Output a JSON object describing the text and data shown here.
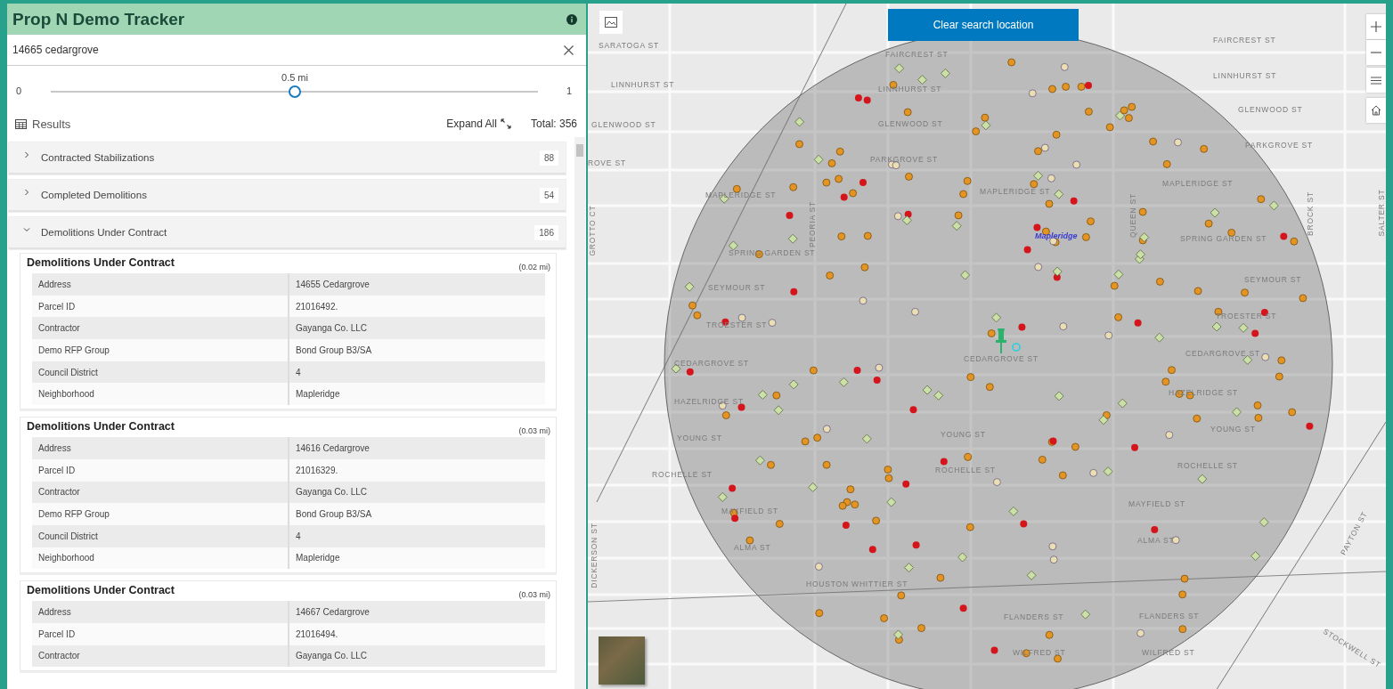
{
  "app": {
    "title": "Prop N Demo Tracker"
  },
  "search": {
    "value": "14665 cedargrove"
  },
  "radius": {
    "label": "0.5 mi",
    "min": "0",
    "max": "1",
    "level": 0.5
  },
  "results": {
    "title": "Results",
    "expand_all": "Expand All",
    "total": "Total: 356"
  },
  "groups": [
    {
      "title": "Contracted Stabilizations",
      "count": "88",
      "expanded": false
    },
    {
      "title": "Completed Demolitions",
      "count": "54",
      "expanded": false
    },
    {
      "title": "Demolitions Under Contract",
      "count": "186",
      "expanded": true,
      "records": [
        {
          "title": "Demolitions Under Contract",
          "distance": "(0.02 mi)",
          "fields": [
            {
              "label": "Address",
              "value": "14655 Cedargrove"
            },
            {
              "label": "Parcel ID",
              "value": "21016492."
            },
            {
              "label": "Contractor",
              "value": "Gayanga Co. LLC"
            },
            {
              "label": "Demo RFP Group",
              "value": "Bond Group B3/SA"
            },
            {
              "label": "Council District",
              "value": "4"
            },
            {
              "label": "Neighborhood",
              "value": "Mapleridge"
            }
          ]
        },
        {
          "title": "Demolitions Under Contract",
          "distance": "(0.03 mi)",
          "fields": [
            {
              "label": "Address",
              "value": "14616 Cedargrove"
            },
            {
              "label": "Parcel ID",
              "value": "21016329."
            },
            {
              "label": "Contractor",
              "value": "Gayanga Co. LLC"
            },
            {
              "label": "Demo RFP Group",
              "value": "Bond Group B3/SA"
            },
            {
              "label": "Council District",
              "value": "4"
            },
            {
              "label": "Neighborhood",
              "value": "Mapleridge"
            }
          ]
        },
        {
          "title": "Demolitions Under Contract",
          "distance": "(0.03 mi)",
          "fields": [
            {
              "label": "Address",
              "value": "14667 Cedargrove"
            },
            {
              "label": "Parcel ID",
              "value": "21016494."
            },
            {
              "label": "Contractor",
              "value": "Gayanga Co. LLC"
            }
          ]
        }
      ]
    }
  ],
  "map": {
    "clear_button": "Clear search location",
    "neighborhood_label": "Mapleridge",
    "streets": [
      {
        "text": "SARATOGA ST"
      },
      {
        "text": "LINNHURST ST"
      },
      {
        "text": "GLENWOOD ST"
      },
      {
        "text": "ROVE ST"
      },
      {
        "text": "MAPLERIDGE ST"
      },
      {
        "text": "SPRING GARDEN ST"
      },
      {
        "text": "SEYMOUR ST"
      },
      {
        "text": "TROESTER ST"
      },
      {
        "text": "FAIRCREST ST"
      },
      {
        "text": "LINNHURST ST"
      },
      {
        "text": "GLENWOOD ST"
      },
      {
        "text": "PARKGROVE ST"
      },
      {
        "text": "MAPLERIDGE ST"
      },
      {
        "text": "MAPLERIDGE ST"
      },
      {
        "text": "FAIRCREST ST"
      },
      {
        "text": "LINNHURST ST"
      },
      {
        "text": "GLENWOOD ST"
      },
      {
        "text": "PARKGROVE ST"
      },
      {
        "text": "SPRING GARDEN ST"
      },
      {
        "text": "SEYMOUR ST"
      },
      {
        "text": "TROESTER ST"
      },
      {
        "text": "CEDARGROVE ST"
      },
      {
        "text": "CEDARGROVE ST"
      },
      {
        "text": "CEDARGROVE ST"
      },
      {
        "text": "HAZELRIDGE ST"
      },
      {
        "text": "HAZELRIDGE ST"
      },
      {
        "text": "YOUNG ST"
      },
      {
        "text": "YOUNG ST"
      },
      {
        "text": "YOUNG ST"
      },
      {
        "text": "ROCHELLE ST"
      },
      {
        "text": "ROCHELLE ST"
      },
      {
        "text": "ROCHELLE ST"
      },
      {
        "text": "MAYFIELD ST"
      },
      {
        "text": "MAYFIELD ST"
      },
      {
        "text": "ALMA ST"
      },
      {
        "text": "ALMA ST"
      },
      {
        "text": "HOUSTON WHITTIER ST"
      },
      {
        "text": "FLANDERS ST"
      },
      {
        "text": "FLANDERS ST"
      },
      {
        "text": "WILFRED ST"
      },
      {
        "text": "WILFRED ST"
      },
      {
        "text": "GROTTO CT"
      },
      {
        "text": "PEORIA ST"
      },
      {
        "text": "QUEEN ST"
      },
      {
        "text": "BROCK ST"
      },
      {
        "text": "SALTER ST"
      },
      {
        "text": "DICKERSON ST"
      },
      {
        "text": "PAYTON ST"
      },
      {
        "text": "STOCKWELL ST"
      }
    ]
  }
}
